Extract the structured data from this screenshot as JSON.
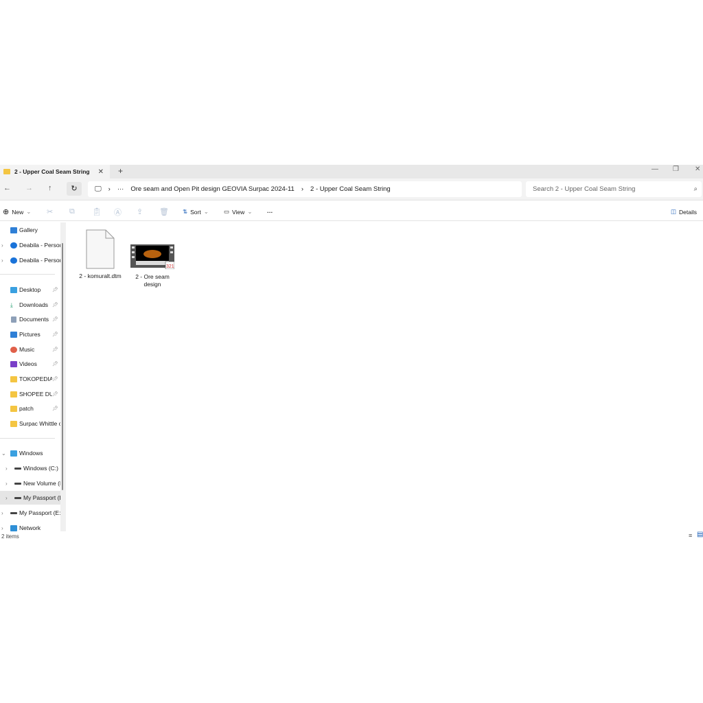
{
  "tab": {
    "title": "2 - Upper Coal Seam String"
  },
  "address": {
    "ellipsis": "···",
    "crumbs": [
      "Ore seam and Open Pit design GEOVIA Surpac 2024-11",
      "2 - Upper Coal Seam String"
    ],
    "search_placeholder": "Search 2 - Upper Coal Seam String"
  },
  "toolbar": {
    "new": "New",
    "sort": "Sort",
    "view": "View",
    "more": "···",
    "details": "Details"
  },
  "sidebar": {
    "items": [
      {
        "label": "Gallery"
      },
      {
        "label": "Deabila - Persor"
      },
      {
        "label": "Deabila - Persor"
      },
      {
        "label": "Desktop"
      },
      {
        "label": "Downloads"
      },
      {
        "label": "Documents"
      },
      {
        "label": "Pictures"
      },
      {
        "label": "Music"
      },
      {
        "label": "Videos"
      },
      {
        "label": "TOKOPEDIA S"
      },
      {
        "label": "SHOPEE DUI"
      },
      {
        "label": "patch"
      },
      {
        "label": "Surpac Whittle c"
      },
      {
        "label": "Windows"
      },
      {
        "label": "Windows (C:)"
      },
      {
        "label": "New Volume (I"
      },
      {
        "label": "My Passport (E"
      },
      {
        "label": "My Passport (E:)"
      },
      {
        "label": "Network"
      }
    ]
  },
  "files": [
    {
      "name": "2 - komuralt.dtm"
    },
    {
      "name": "2 - Ore seam design"
    }
  ],
  "status": {
    "count": "2 items"
  }
}
